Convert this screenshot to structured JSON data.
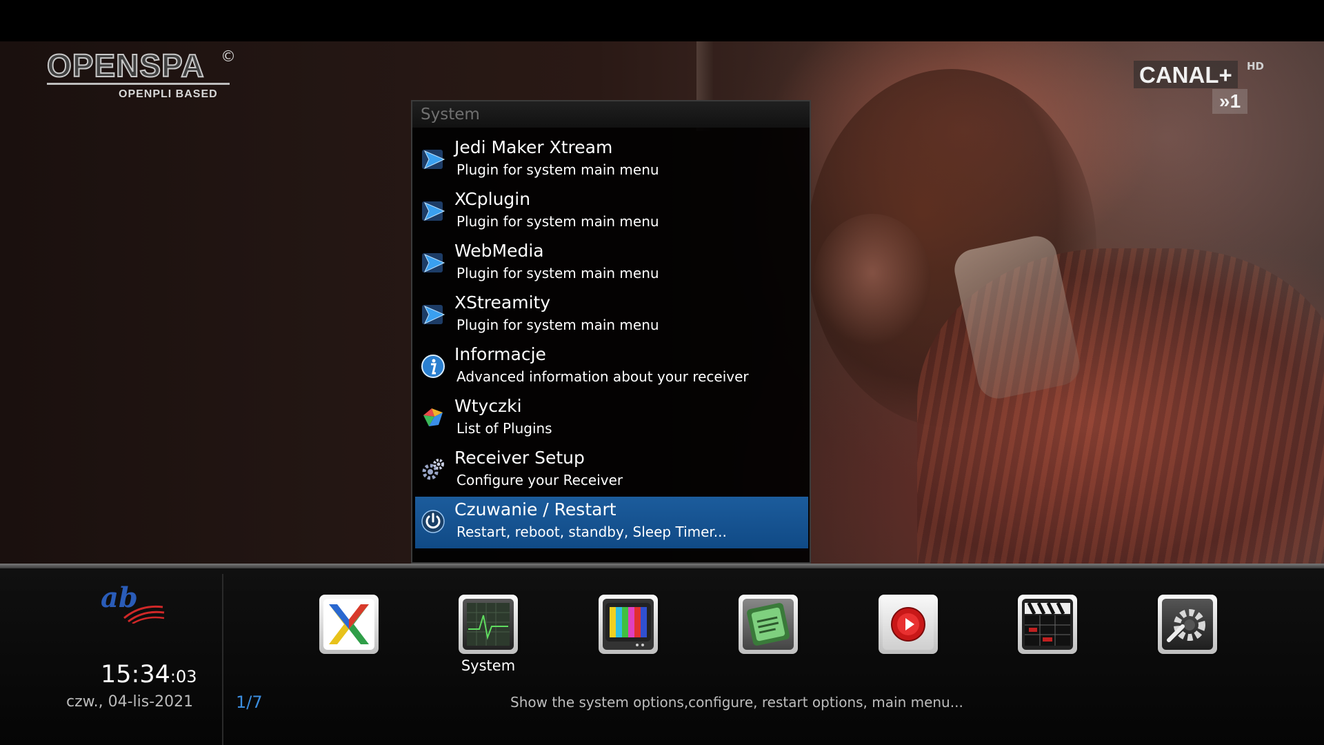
{
  "brand": {
    "logo_text": "OPENSPA",
    "logo_mark": "©",
    "logo_subtitle": "OPENPLI BASED"
  },
  "channel": {
    "name": "CANAL+",
    "quality": "HD",
    "number": "»1"
  },
  "menu": {
    "title": "System",
    "items": [
      {
        "title": "Jedi Maker Xtream",
        "desc": "Plugin for system main menu",
        "icon": "play-arrow-icon",
        "selected": false
      },
      {
        "title": "XCplugin",
        "desc": "Plugin for system main menu",
        "icon": "play-arrow-icon",
        "selected": false
      },
      {
        "title": "WebMedia",
        "desc": "Plugin for system main menu",
        "icon": "play-arrow-icon",
        "selected": false
      },
      {
        "title": "XStreamity",
        "desc": "Plugin for system main menu",
        "icon": "play-arrow-icon",
        "selected": false
      },
      {
        "title": "Informacje",
        "desc": "Advanced information about your receiver",
        "icon": "info-icon",
        "selected": false
      },
      {
        "title": "Wtyczki",
        "desc": "List of Plugins",
        "icon": "plugins-icon",
        "selected": false
      },
      {
        "title": "Receiver Setup",
        "desc": "Configure your Receiver",
        "icon": "gears-icon",
        "selected": false
      },
      {
        "title": "Czuwanie / Restart",
        "desc": "Restart, reboot, standby, Sleep Timer...",
        "icon": "power-icon",
        "selected": true
      }
    ]
  },
  "bottom": {
    "provider_logo": "ab",
    "time": "15:34",
    "seconds": ":03",
    "date": "czw., 04-lis-2021",
    "pager": "1/7",
    "status": "Show the system options,configure, restart options, main menu...",
    "selected_label": "System",
    "icons": [
      "x-plugin-icon",
      "system-monitor-icon",
      "tv-icon",
      "openspa-cam-icon",
      "record-icon",
      "clapperboard-icon",
      "settings-gear-icon"
    ]
  },
  "colors": {
    "selection": "#1a5a9a",
    "pager": "#3b8ee0"
  }
}
